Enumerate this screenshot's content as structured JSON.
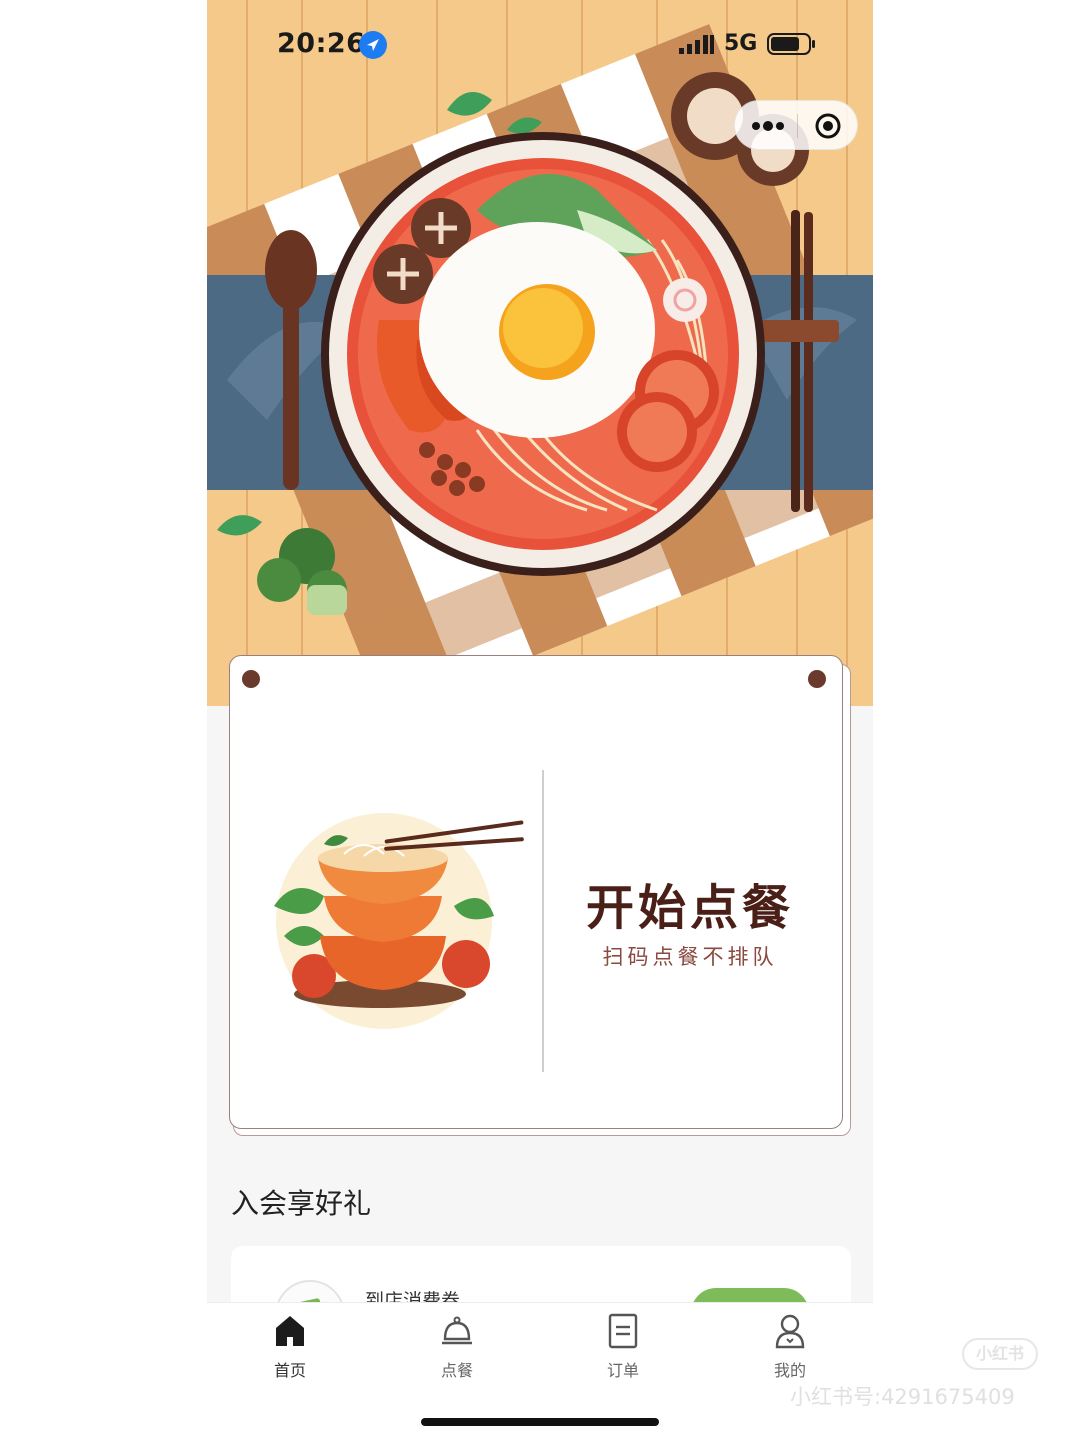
{
  "status_bar": {
    "time": "20:26",
    "network": "5G",
    "icons": [
      "location-arrow-icon",
      "signal-bars-icon",
      "battery-icon"
    ]
  },
  "capsule": {
    "icons": [
      "more-dots-icon",
      "close-target-icon"
    ]
  },
  "order_card": {
    "title": "开始点餐",
    "subtitle": "扫码点餐不排队"
  },
  "member_section": {
    "title": "入会享好礼",
    "coupon_label": "到店消费券"
  },
  "tabbar": {
    "tabs": [
      {
        "label": "首页",
        "icon": "home-icon",
        "active": true
      },
      {
        "label": "点餐",
        "icon": "cloche-icon",
        "active": false
      },
      {
        "label": "订单",
        "icon": "order-list-icon",
        "active": false
      },
      {
        "label": "我的",
        "icon": "profile-icon",
        "active": false
      }
    ]
  },
  "watermark": {
    "logo_text": "小红书",
    "id_text": "小红书号:4291675409"
  },
  "colors": {
    "accent_green": "#7ebc5a",
    "title_brown": "#4a1f17",
    "subtitle_brown": "#8a4a3f",
    "table_wood": "#f5c98a",
    "runner_blue": "#4d6a85"
  }
}
